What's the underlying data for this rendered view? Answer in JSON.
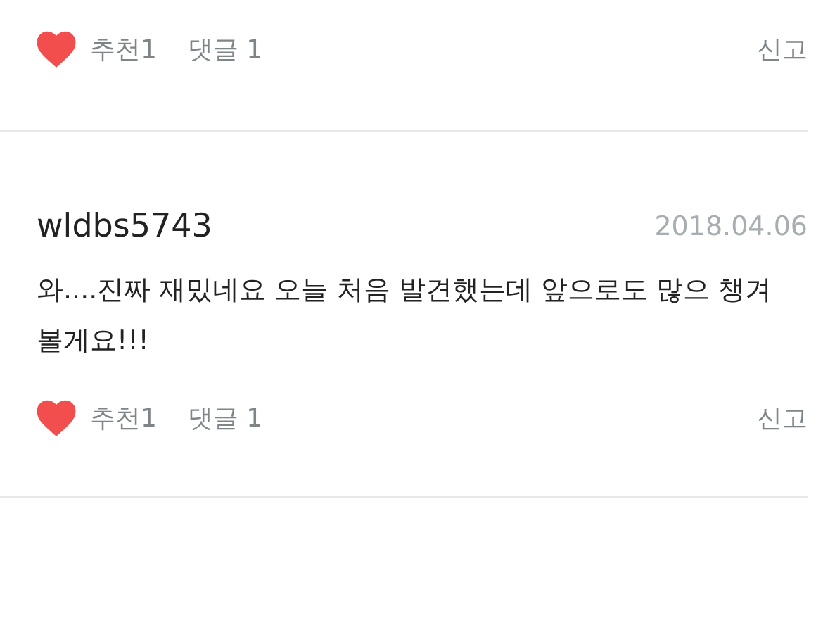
{
  "comments": [
    {
      "liked": true,
      "likes_label": "추천1",
      "replies_label": "댓글 1",
      "report": "신고"
    },
    {
      "author": "wldbs5743",
      "date": "2018.04.06",
      "text": "와....진짜 재밌네요 오늘 처음 발견했는데 앞으로도 많으 챙겨볼게요!!!",
      "liked": true,
      "likes_label": "추천1",
      "replies_label": "댓글 1",
      "report": "신고"
    }
  ]
}
